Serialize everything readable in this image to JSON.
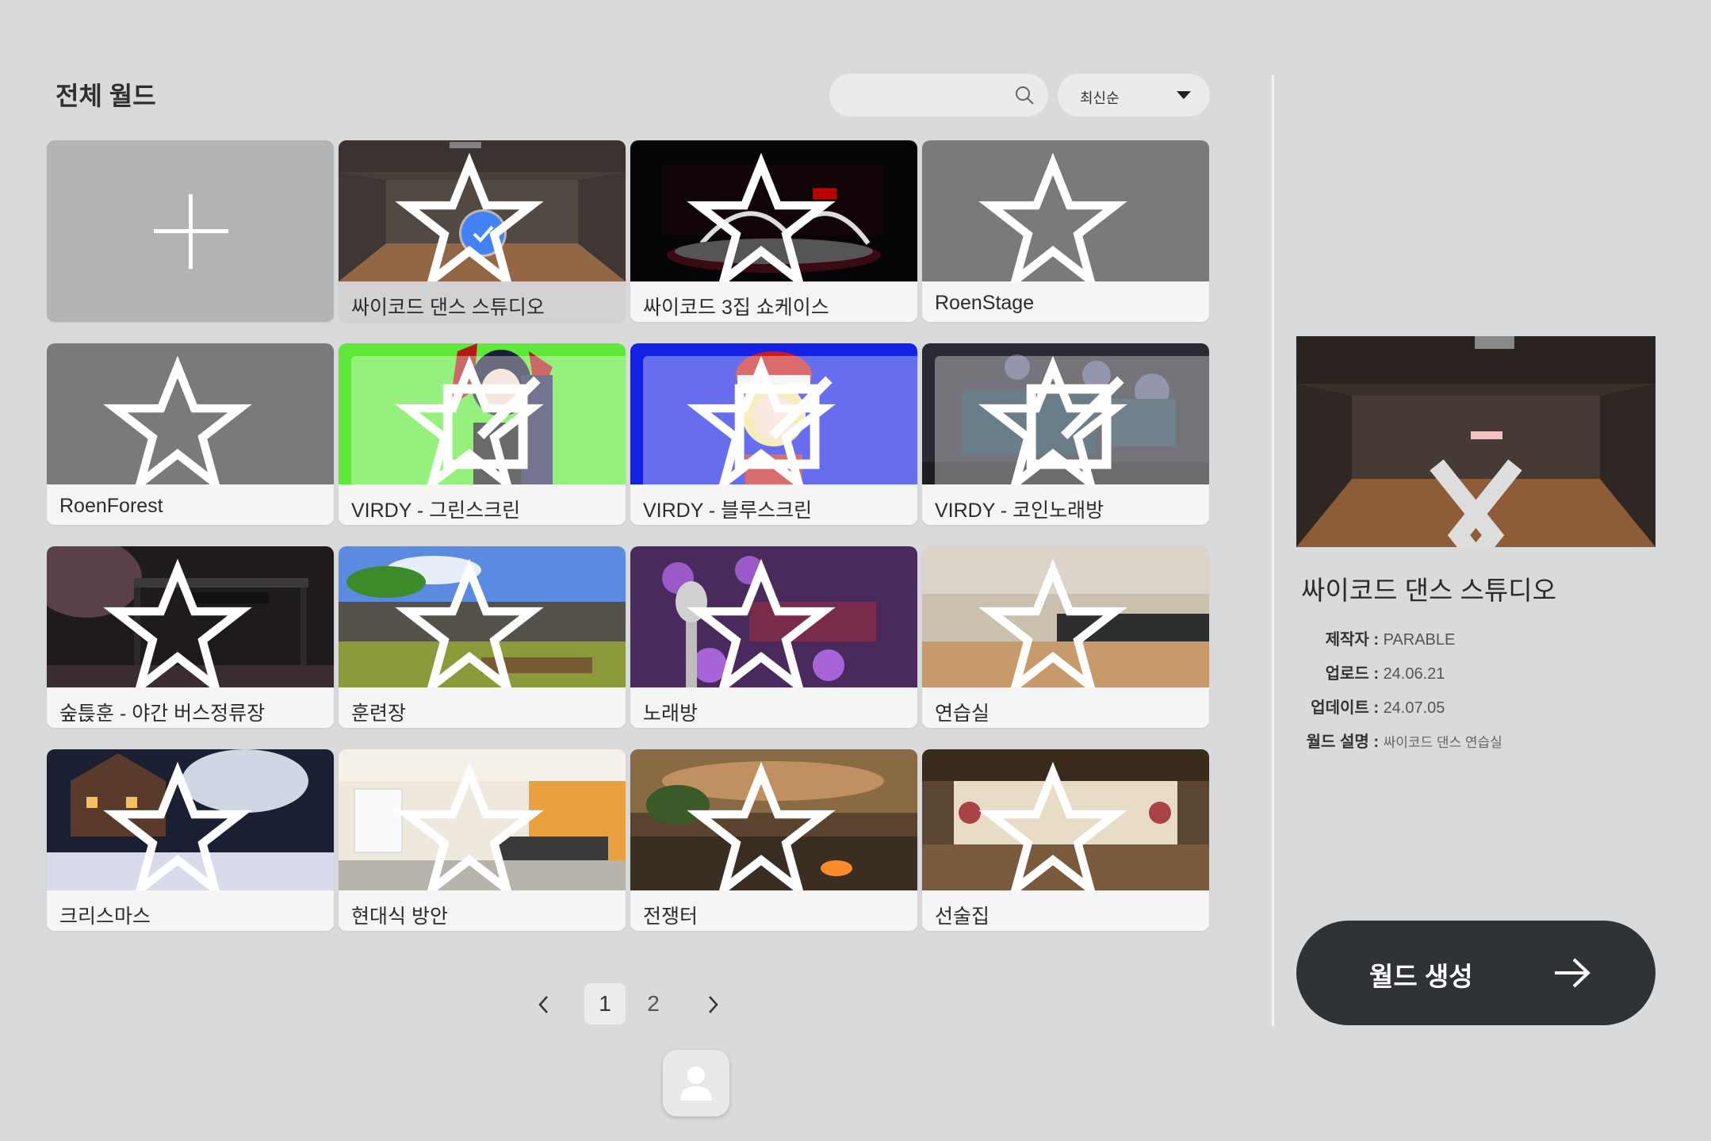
{
  "header": {
    "title": "전체 월드",
    "search_placeholder": "",
    "sort_label": "최신순"
  },
  "worlds": [
    {
      "name": "싸이코드 댄스 스튜디오",
      "selected": true,
      "editable": false
    },
    {
      "name": "싸이코드 3집 쇼케이스",
      "editable": false
    },
    {
      "name": "RoenStage",
      "editable": false
    },
    {
      "name": "RoenForest",
      "editable": false
    },
    {
      "name": "VIRDY - 그린스크린",
      "editable": true
    },
    {
      "name": "VIRDY - 블루스크린",
      "editable": true
    },
    {
      "name": "VIRDY - 코인노래방",
      "editable": true
    },
    {
      "name": "숲튽훈 - 야간 버스정류장",
      "editable": false
    },
    {
      "name": "훈련장",
      "editable": false
    },
    {
      "name": "노래방",
      "editable": false
    },
    {
      "name": "연습실",
      "editable": false
    },
    {
      "name": "크리스마스",
      "editable": false
    },
    {
      "name": "현대식 방안",
      "editable": false
    },
    {
      "name": "전쟁터",
      "editable": false
    },
    {
      "name": "선술집",
      "editable": false
    }
  ],
  "pagination": {
    "pages": [
      "1",
      "2"
    ],
    "current": "1"
  },
  "detail": {
    "title": "싸이코드 댄스 스튜디오",
    "creator_label": "제작자 :",
    "creator": "PARABLE",
    "upload_label": "업로드 :",
    "upload": "24.06.21",
    "update_label": "업데이트 :",
    "update": "24.07.05",
    "desc_label": "월드 설명 :",
    "desc": "싸이코드 댄스 연습실"
  },
  "create_button": {
    "label": "월드 생성"
  },
  "colors": {
    "background": "#d9dadc",
    "button_dark": "#2f3236",
    "check_blue": "#3478f6"
  }
}
